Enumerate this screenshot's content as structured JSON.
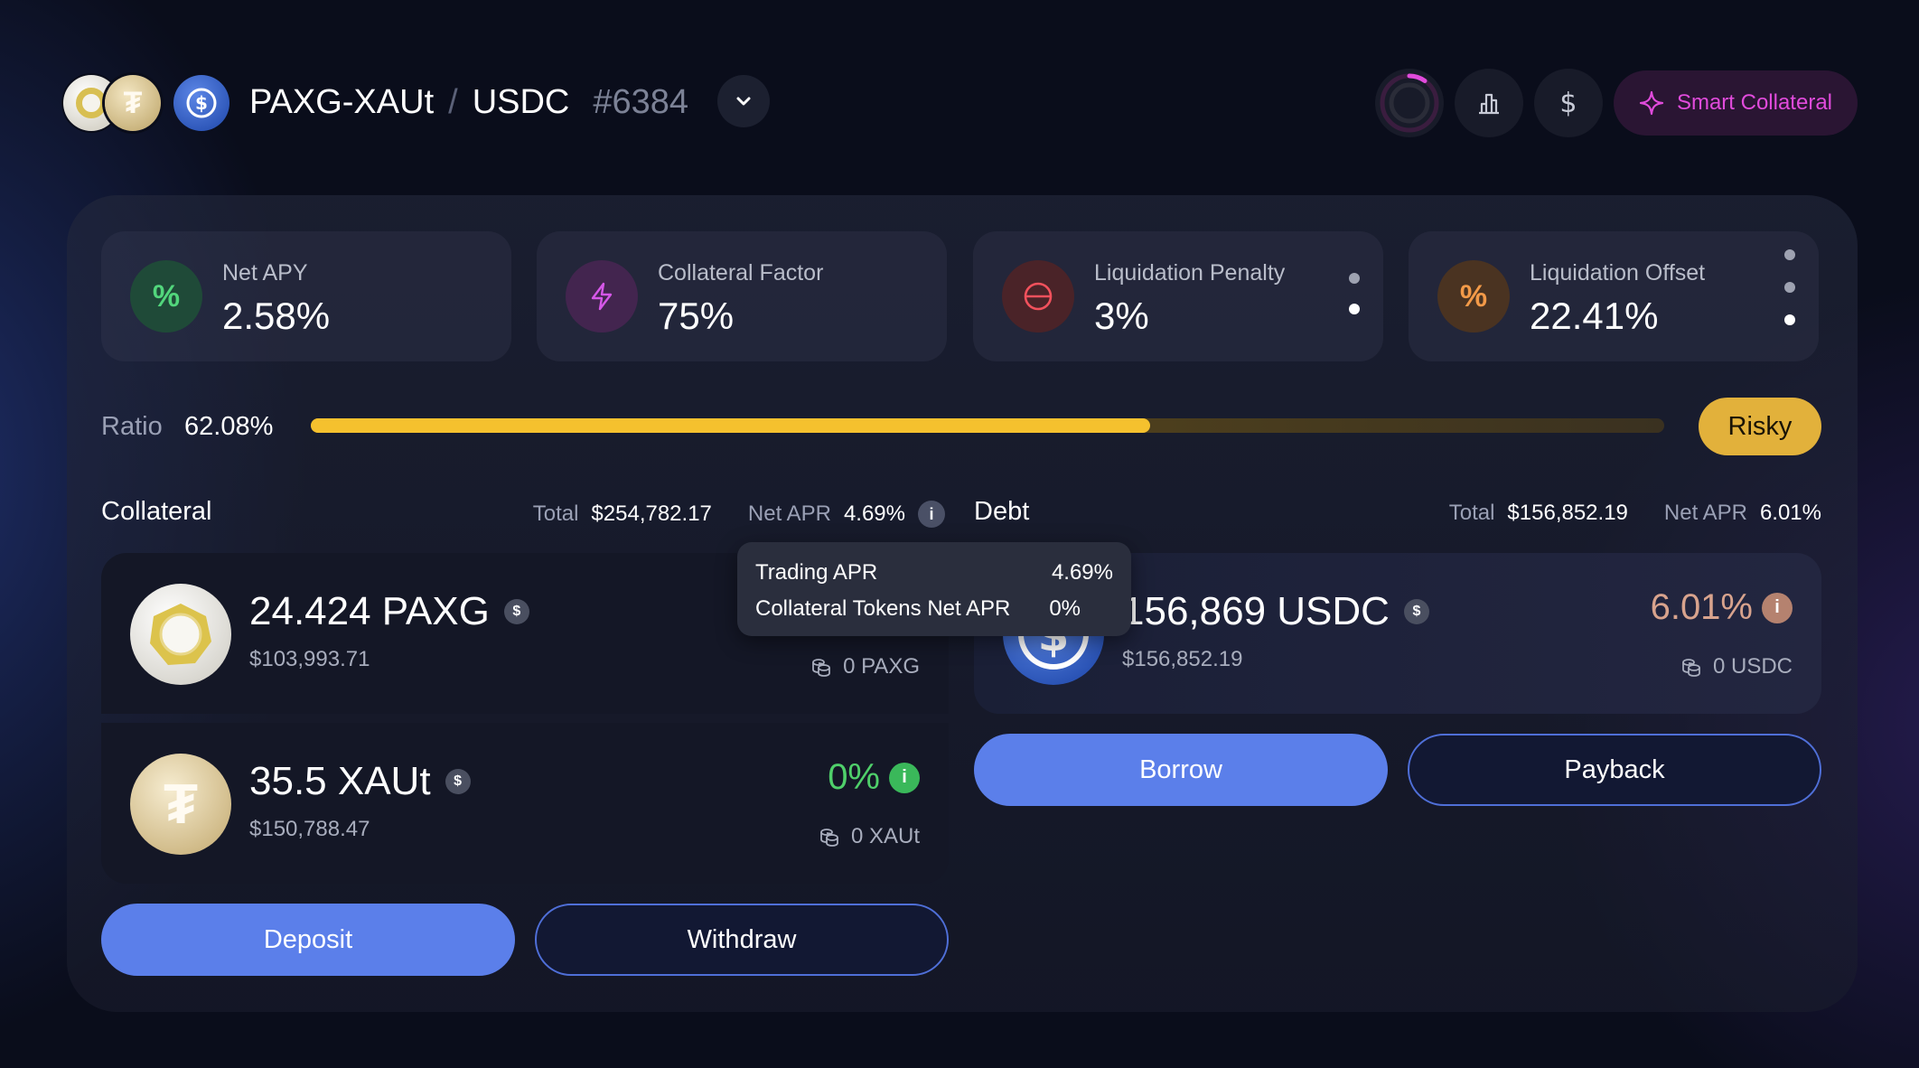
{
  "header": {
    "base_pair": "PAXG-XAUt",
    "separator": "/",
    "quote": "USDC",
    "position_id": "#6384",
    "smart_button_label": "Smart Collateral"
  },
  "stats": [
    {
      "label": "Net APY",
      "value": "2.58%",
      "icon": "percent-icon"
    },
    {
      "label": "Collateral Factor",
      "value": "75%",
      "icon": "lightning-icon"
    },
    {
      "label": "Liquidation Penalty",
      "value": "3%",
      "icon": "minus-circle-icon"
    },
    {
      "label": "Liquidation Offset",
      "value": "22.41%",
      "icon": "percent-icon"
    }
  ],
  "ratio": {
    "label": "Ratio",
    "value": "62.08%",
    "fill_fraction": 0.62,
    "badge": "Risky"
  },
  "collateral": {
    "title": "Collateral",
    "total_label": "Total",
    "total_value": "$254,782.17",
    "apr_label": "Net APR",
    "apr_value": "4.69%",
    "assets": [
      {
        "amount": "24.424 PAXG",
        "usd": "$103,993.71",
        "apr": "",
        "balance": "0 PAXG"
      },
      {
        "amount": "35.5 XAUt",
        "usd": "$150,788.47",
        "apr": "0%",
        "balance": "0 XAUt"
      }
    ],
    "deposit_label": "Deposit",
    "withdraw_label": "Withdraw"
  },
  "tooltip": {
    "rows": [
      {
        "label": "Trading APR",
        "value": "4.69%"
      },
      {
        "label": "Collateral Tokens Net APR",
        "value": "0%"
      }
    ]
  },
  "debt": {
    "title": "Debt",
    "total_label": "Total",
    "total_value": "$156,852.19",
    "apr_label": "Net APR",
    "apr_value": "6.01%",
    "asset": {
      "amount": "156,869 USDC",
      "usd": "$156,852.19",
      "apr": "6.01%",
      "balance": "0 USDC"
    },
    "borrow_label": "Borrow",
    "payback_label": "Payback"
  },
  "colors": {
    "accent_blue": "#5b7fea",
    "ratio_yellow": "#f5c12e",
    "risky_badge": "#e2b13b",
    "positive_green": "#4fcf6a",
    "debt_apr": "#d8a38d",
    "smart_pink": "#e14bdc"
  }
}
